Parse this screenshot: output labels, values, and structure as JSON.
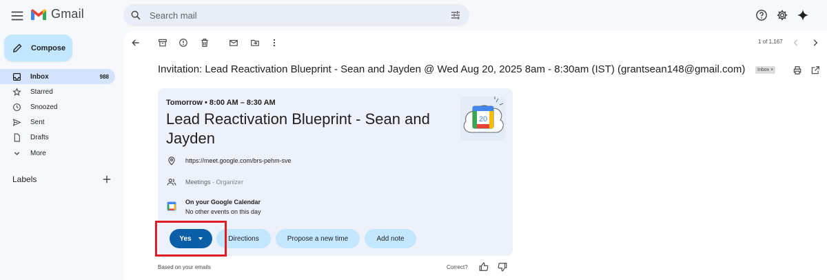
{
  "app": {
    "name": "Gmail",
    "search_placeholder": "Search mail"
  },
  "compose_label": "Compose",
  "sidebar": {
    "items": [
      {
        "label": "Inbox",
        "count": "988",
        "icon": "inbox-icon",
        "active": true
      },
      {
        "label": "Starred",
        "count": "",
        "icon": "star-icon"
      },
      {
        "label": "Snoozed",
        "count": "",
        "icon": "clock-icon"
      },
      {
        "label": "Sent",
        "count": "",
        "icon": "send-icon"
      },
      {
        "label": "Drafts",
        "count": "",
        "icon": "draft-icon"
      },
      {
        "label": "More",
        "count": "",
        "icon": "chevron-down-icon"
      }
    ],
    "labels_title": "Labels"
  },
  "pager": {
    "text": "1 of 1,167"
  },
  "email": {
    "subject": "Invitation: Lead Reactivation Blueprint - Sean and Jayden @ Wed Aug 20, 2025 8am - 8:30am (IST) (grantsean148@gmail.com)",
    "inbox_badge": "Inbox"
  },
  "event": {
    "when": "Tomorrow • 8:00 AM – 8:30 AM",
    "title": "Lead Reactivation Blueprint - Sean and Jayden",
    "location": "https://meet.google.com/brs-pehm-sve",
    "guests": "Meetings",
    "guests_role": "- Organizer",
    "calendar_title": "On your Google Calendar",
    "calendar_sub": "No other events on this day",
    "calendar_day": "20"
  },
  "actions": {
    "yes": "Yes",
    "directions": "Directions",
    "propose": "Propose a new time",
    "add_note": "Add note"
  },
  "footer": {
    "based_on": "Based on your emails",
    "correct": "Correct?"
  },
  "colors": {
    "highlight_box": "#e01b24",
    "primary_button": "#0b5fa8",
    "pill": "#c2e7ff",
    "inbox_active": "#d3e3fd"
  }
}
